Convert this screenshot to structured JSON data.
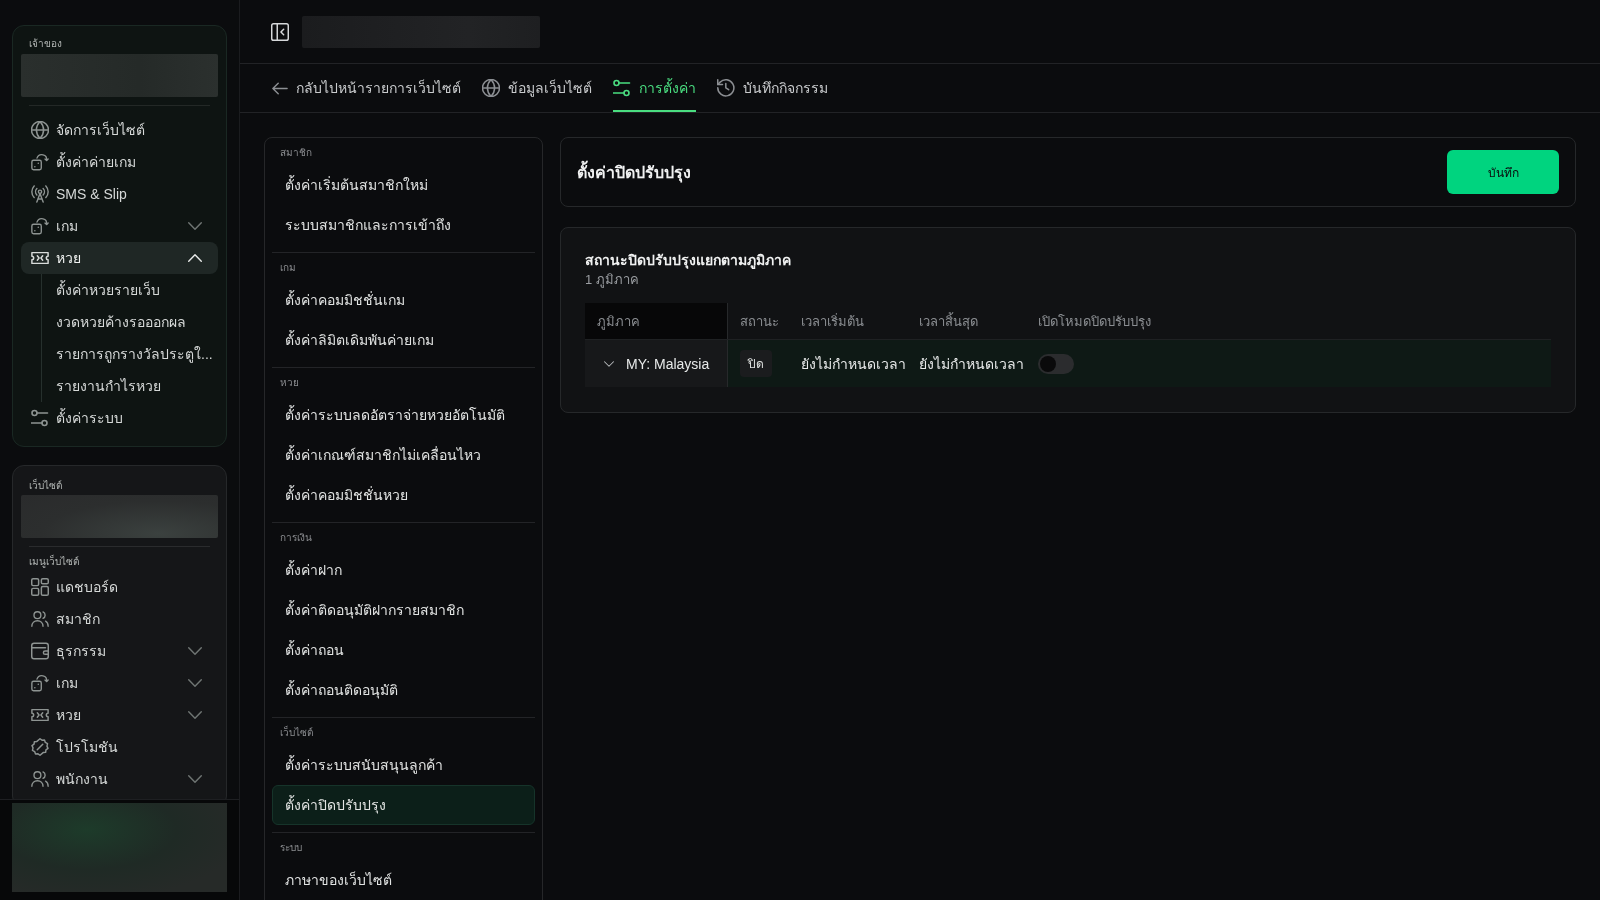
{
  "sidebar": {
    "owner_panel": {
      "label": "เจ้าของ",
      "items": [
        {
          "kind": "link",
          "label": "จัดการเว็บไซต์",
          "selected": false
        },
        {
          "kind": "link",
          "label": "ตั้งค่าค่ายเกม",
          "selected": false
        },
        {
          "kind": "link",
          "label": "SMS & Slip",
          "selected": false
        },
        {
          "kind": "group",
          "label": "เกม",
          "selected": false,
          "expanded": false
        },
        {
          "kind": "group",
          "label": "หวย",
          "selected": true,
          "expanded": true,
          "children": [
            {
              "label": "ตั้งค่าหวยรายเว็บ",
              "selected": false
            },
            {
              "label": "งวดหวยค้างรอออกผล",
              "selected": false
            },
            {
              "label": "รายการถูกรางวัลประตูใ...",
              "selected": false
            },
            {
              "label": "รายงานกำไรหวย",
              "selected": false
            }
          ]
        },
        {
          "kind": "link",
          "label": "ตั้งค่าระบบ",
          "selected": false
        }
      ]
    },
    "website_panel": {
      "label": "เว็บไซต์",
      "menu_label": "เมนูเว็บไซต์",
      "items": [
        {
          "kind": "link",
          "label": "แดชบอร์ด",
          "selected": false
        },
        {
          "kind": "link",
          "label": "สมาชิก",
          "selected": false
        },
        {
          "kind": "group",
          "label": "ธุรกรรม",
          "selected": false,
          "expanded": false
        },
        {
          "kind": "group",
          "label": "เกม",
          "selected": false,
          "expanded": false
        },
        {
          "kind": "group",
          "label": "หวย",
          "selected": false,
          "expanded": false
        },
        {
          "kind": "link",
          "label": "โปรโมชัน",
          "selected": false
        },
        {
          "kind": "group",
          "label": "พนักงาน",
          "selected": false,
          "expanded": false
        }
      ]
    }
  },
  "back_link": {
    "label": "กลับไปหน้ารายการเว็บไซต์"
  },
  "tabs": [
    {
      "label": "ข้อมูลเว็บไซต์",
      "selected": false
    },
    {
      "label": "การตั้งค่า",
      "selected": true
    },
    {
      "label": "บันทึกกิจกรรม",
      "selected": false
    }
  ],
  "settings_menu": {
    "groups": [
      {
        "label": "สมาชิก",
        "items": [
          {
            "label": "ตั้งค่าเริ่มต้นสมาชิกใหม่",
            "selected": false
          },
          {
            "label": "ระบบสมาชิกและการเข้าถึง",
            "selected": false
          }
        ]
      },
      {
        "label": "เกม",
        "items": [
          {
            "label": "ตั้งค่าคอมมิชชั่นเกม",
            "selected": false
          },
          {
            "label": "ตั้งค่าลิมิตเดิมพันค่ายเกม",
            "selected": false
          }
        ]
      },
      {
        "label": "หวย",
        "items": [
          {
            "label": "ตั้งค่าระบบลดอัตราจ่ายหวยอัตโนมัติ",
            "selected": false
          },
          {
            "label": "ตั้งค่าเกณฑ์สมาชิกไม่เคลื่อนไหว",
            "selected": false
          },
          {
            "label": "ตั้งค่าคอมมิชชั่นหวย",
            "selected": false
          }
        ]
      },
      {
        "label": "การเงิน",
        "items": [
          {
            "label": "ตั้งค่าฝาก",
            "selected": false
          },
          {
            "label": "ตั้งค่าติดอนุมัติฝากรายสมาชิก",
            "selected": false
          },
          {
            "label": "ตั้งค่าถอน",
            "selected": false
          },
          {
            "label": "ตั้งค่าถอนติดอนุมัติ",
            "selected": false
          }
        ]
      },
      {
        "label": "เว็บไซต์",
        "items": [
          {
            "label": "ตั้งค่าระบบสนับสนุนลูกค้า",
            "selected": false
          },
          {
            "label": "ตั้งค่าปิดปรับปรุง",
            "selected": true
          }
        ]
      },
      {
        "label": "ระบบ",
        "items": [
          {
            "label": "ภาษาของเว็บไซต์",
            "selected": false
          }
        ]
      }
    ]
  },
  "page_header": {
    "title": "ตั้งค่าปิดปรับปรุง",
    "save_button": "บันทึก"
  },
  "region_status": {
    "title": "สถานะปิดปรับปรุงแยกตามภูมิภาค",
    "count": "1 ภูมิภาค",
    "table": {
      "columns": [
        "ภูมิภาค",
        "สถานะ",
        "เวลาเริ่มต้น",
        "เวลาสิ้นสุด",
        "เปิดโหมดปิดปรับปรุง"
      ],
      "rows": [
        {
          "region": "MY: Malaysia",
          "expanded": false,
          "status": "ปิด",
          "start_time": "ยังไม่กำหนดเวลา",
          "end_time": "ยังไม่กำหนดเวลา",
          "maintenance_on": false
        }
      ]
    }
  }
}
